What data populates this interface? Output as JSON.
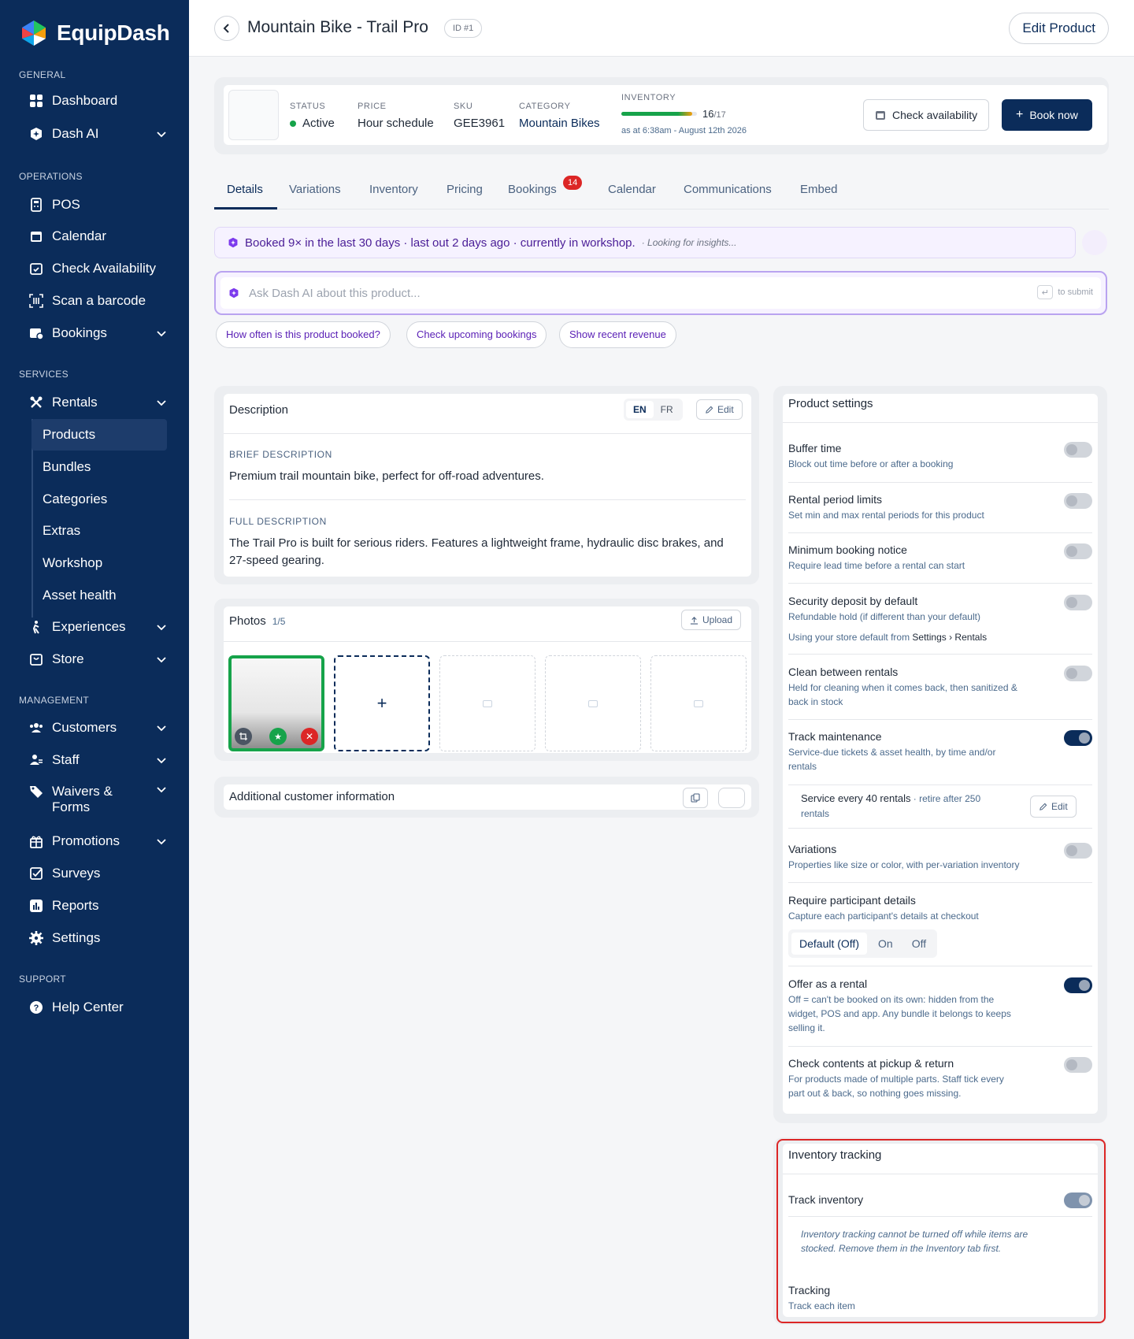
{
  "brand": {
    "name": "EquipDash"
  },
  "sidebar": {
    "sections": {
      "general": "GENERAL",
      "operations": "OPERATIONS",
      "services": "SERVICES",
      "management": "MANAGEMENT",
      "support": "SUPPORT"
    },
    "items": {
      "dashboard": "Dashboard",
      "dash_ai": "Dash AI",
      "pos": "POS",
      "calendar": "Calendar",
      "check_availability": "Check Availability",
      "scan_barcode": "Scan a barcode",
      "bookings": "Bookings",
      "rentals": "Rentals",
      "products": "Products",
      "bundles": "Bundles",
      "categories": "Categories",
      "extras": "Extras",
      "workshop": "Workshop",
      "asset_health": "Asset health",
      "experiences": "Experiences",
      "store": "Store",
      "customers": "Customers",
      "staff": "Staff",
      "waivers_line1": "Waivers &",
      "waivers_line2": "Forms",
      "promotions": "Promotions",
      "surveys": "Surveys",
      "reports": "Reports",
      "settings": "Settings",
      "help_center": "Help Center"
    },
    "active_item": "Products"
  },
  "header": {
    "title": "Mountain Bike - Trail Pro",
    "id_badge": "ID #1",
    "edit_button": "Edit Product"
  },
  "summary": {
    "status_label": "STATUS",
    "status_value": "Active",
    "price_label": "PRICE",
    "price_value": "Hour schedule",
    "sku_label": "SKU",
    "sku_value": "GEE3961",
    "category_label": "CATEGORY",
    "category_value": "Mountain Bikes",
    "inventory_label": "INVENTORY",
    "inventory_count": "16",
    "inventory_total": "/17",
    "inventory_fraction": 0.94,
    "inventory_asof": "as at 6:38am - August 12th 2026",
    "check_availability": "Check availability",
    "book_now": "Book now"
  },
  "tabs": [
    {
      "label": "Details"
    },
    {
      "label": "Variations"
    },
    {
      "label": "Inventory"
    },
    {
      "label": "Pricing"
    },
    {
      "label": "Bookings",
      "badge": "14"
    },
    {
      "label": "Calendar"
    },
    {
      "label": "Communications"
    },
    {
      "label": "Embed"
    }
  ],
  "insight": {
    "text": "Booked 9× in the last 30 days · last out 2 days ago · currently in workshop.",
    "status": "· Looking for insights..."
  },
  "ask_ai": {
    "placeholder": "Ask Dash AI about this product...",
    "submit_hint": "to submit",
    "submit_key": "↵"
  },
  "suggestions": [
    "How often is this product booked?",
    "Check upcoming bookings",
    "Show recent revenue"
  ],
  "description": {
    "title": "Description",
    "lang_en": "EN",
    "lang_fr": "FR",
    "edit": "Edit",
    "brief_label": "BRIEF DESCRIPTION",
    "brief_text": "Premium trail mountain bike, perfect for off-road adventures.",
    "full_label": "FULL DESCRIPTION",
    "full_text_1": "The Trail Pro is built for serious riders. Features a lightweight frame, hydraulic disc brakes, and",
    "full_text_2": "27-speed gearing."
  },
  "photos": {
    "title": "Photos",
    "count": "1/5",
    "upload": "Upload",
    "add_symbol": "+"
  },
  "additional_info": {
    "title": "Additional customer information"
  },
  "product_settings": {
    "title": "Product settings",
    "buffer_time": {
      "title": "Buffer time",
      "desc": "Block out time before or after a booking"
    },
    "rental_period": {
      "title": "Rental period limits",
      "desc": "Set min and max rental periods for this product"
    },
    "min_notice": {
      "title": "Minimum booking notice",
      "desc": "Require lead time before a rental can start"
    },
    "deposit": {
      "title": "Security deposit by default",
      "desc": "Refundable hold (if different than your default)",
      "note_prefix": "Using your store default from ",
      "note_link": "Settings › Rentals"
    },
    "clean": {
      "title": "Clean between rentals",
      "desc_1": "Held for cleaning when it comes back, then sanitized &",
      "desc_2": "back in stock"
    },
    "maintenance": {
      "title": "Track maintenance",
      "desc_1": "Service-due tickets & asset health, by time and/or",
      "desc_2": "rentals",
      "service_text": "Service every 40 rentals",
      "service_extra_1": " · retire after 250",
      "service_extra_2": "rentals",
      "edit": "Edit"
    },
    "variations": {
      "title": "Variations",
      "desc": "Properties like size or color, with per-variation inventory"
    },
    "participant": {
      "title": "Require participant details",
      "desc": "Capture each participant's details at checkout",
      "options": [
        "Default (Off)",
        "On",
        "Off"
      ]
    },
    "offer_rental": {
      "title": "Offer as a rental",
      "desc_1": "Off = can't be booked on its own: hidden from the",
      "desc_2": "widget, POS and app. Any bundle it belongs to keeps",
      "desc_3": "selling it."
    },
    "check_contents": {
      "title": "Check contents at pickup & return",
      "desc_1": "For products made of multiple parts. Staff tick every",
      "desc_2": "part out & back, so nothing goes missing."
    }
  },
  "inventory_tracking": {
    "title": "Inventory tracking",
    "track_inventory": "Track inventory",
    "warning_1": "Inventory tracking cannot be turned off while items are",
    "warning_2": "stocked. Remove them in the Inventory tab first.",
    "tracking_title": "Tracking",
    "tracking_desc": "Track each item"
  },
  "colors": {
    "sidebar": "#0b2c5a",
    "primary": "#0b2c5a",
    "ai_purple": "#5b21b6",
    "success": "#16a34a",
    "danger": "#dc2626",
    "link": "#4b6a8c"
  }
}
